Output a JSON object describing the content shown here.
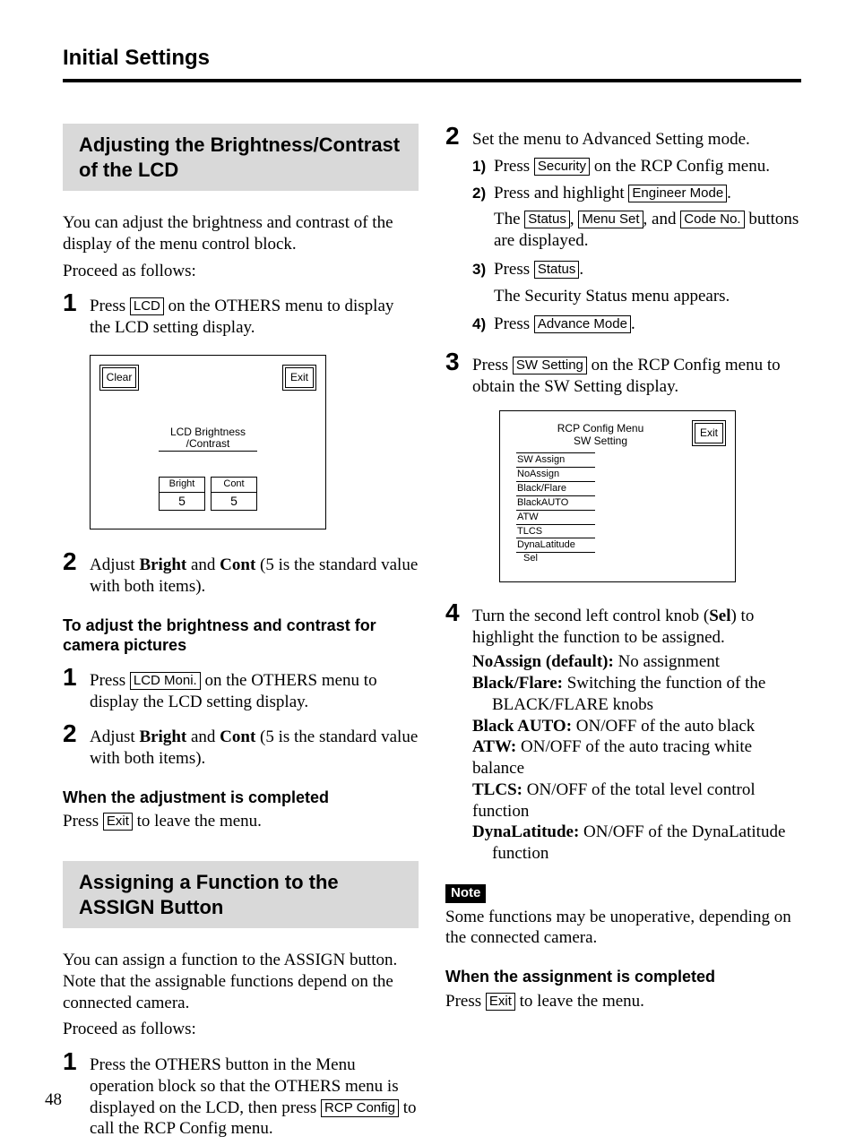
{
  "running_head": "Initial Settings",
  "page_number": "48",
  "left": {
    "sec1_title": "Adjusting the Brightness/Contrast of the LCD",
    "intro1": "You can adjust the brightness and contrast of the display of the menu control block.",
    "intro2": "Proceed as follows:",
    "step1_pre": "Press ",
    "step1_btn": "LCD",
    "step1_post": " on the OTHERS menu to display the LCD setting display.",
    "lcd_fig": {
      "clear": "Clear",
      "exit": "Exit",
      "title_l1": "LCD Brightness",
      "title_l2": "/Contrast",
      "bright_label": "Bright",
      "bright_val": "5",
      "cont_label": "Cont",
      "cont_val": "5"
    },
    "step2_pre": "Adjust ",
    "step2_b1": "Bright",
    "step2_mid": " and ",
    "step2_b2": "Cont",
    "step2_post": " (5 is the standard value with both items).",
    "subh1": "To adjust the brightness and contrast for camera pictures",
    "cp_step1_pre": "Press ",
    "cp_step1_btn": "LCD Moni.",
    "cp_step1_post": " on the OTHERS menu to display the LCD setting display.",
    "cp_step2_pre": "Adjust ",
    "cp_step2_b1": "Bright",
    "cp_step2_mid": " and ",
    "cp_step2_b2": "Cont",
    "cp_step2_post": " (5 is the standard value with both items).",
    "subh2": "When the adjustment is completed",
    "done_pre": "Press ",
    "done_btn": "Exit",
    "done_post": " to leave the menu.",
    "sec2_title": "Assigning a Function to the ASSIGN Button",
    "assign_intro": "You can assign a function to the ASSIGN button. Note that the assignable functions depend on the connected camera.",
    "assign_proceed": "Proceed as follows:",
    "assign_step1_pre": "Press the OTHERS button in the Menu operation block so that the OTHERS menu is displayed on the LCD, then press ",
    "assign_step1_btn": "RCP Config",
    "assign_step1_post": " to call the RCP Config menu."
  },
  "right": {
    "step2_text": "Set the menu to Advanced Setting mode.",
    "ss1_num": "1)",
    "ss1_pre": "Press ",
    "ss1_btn": "Security",
    "ss1_post": " on the RCP Config menu.",
    "ss2_num": "2)",
    "ss2_pre": "Press and highlight ",
    "ss2_btn": "Engineer Mode",
    "ss2_post": ".",
    "ss2_line2_pre": "The ",
    "ss2_b1": "Status",
    "ss2_sep1": ", ",
    "ss2_b2": "Menu Set",
    "ss2_sep2": ", and ",
    "ss2_b3": "Code No.",
    "ss2_line2_post": " buttons are displayed.",
    "ss3_num": "3)",
    "ss3_pre": "Press ",
    "ss3_btn": "Status",
    "ss3_post": ".",
    "ss3_line2": "The Security Status menu appears.",
    "ss4_num": "4)",
    "ss4_pre": "Press ",
    "ss4_btn": "Advance Mode",
    "ss4_post": ".",
    "step3_pre": "Press ",
    "step3_btn": "SW Setting",
    "step3_post": " on the RCP Config menu to obtain the SW Setting display.",
    "sw_fig": {
      "title_l1": "RCP Config Menu",
      "title_l2": "SW Setting",
      "exit": "Exit",
      "items": [
        "SW Assign",
        "NoAssign",
        "Black/Flare",
        "BlackAUTO",
        "ATW",
        "TLCS",
        "DynaLatitude"
      ],
      "sel": "Sel"
    },
    "step4_pre": "Turn the second left control knob (",
    "step4_b": "Sel",
    "step4_post": ") to highlight the function to be assigned.",
    "defs": {
      "d1k": "NoAssign (default):",
      "d1v": "  No assignment",
      "d2k": "Black/Flare:",
      "d2v": " Switching the function of the",
      "d2v2": "BLACK/FLARE knobs",
      "d3k": "Black AUTO:",
      "d3v": " ON/OFF of the auto black",
      "d4k": "ATW:",
      "d4v": " ON/OFF of the auto tracing white balance",
      "d5k": "TLCS:",
      "d5v": " ON/OFF of the total level control function",
      "d6k": "DynaLatitude:",
      "d6v": " ON/OFF of the DynaLatitude",
      "d6v2": "function"
    },
    "note_label": "Note",
    "note_text": "Some functions may be unoperative, depending on the connected camera.",
    "subh": "When the assignment is completed",
    "done_pre": "Press ",
    "done_btn": "Exit",
    "done_post": " to leave the menu."
  }
}
